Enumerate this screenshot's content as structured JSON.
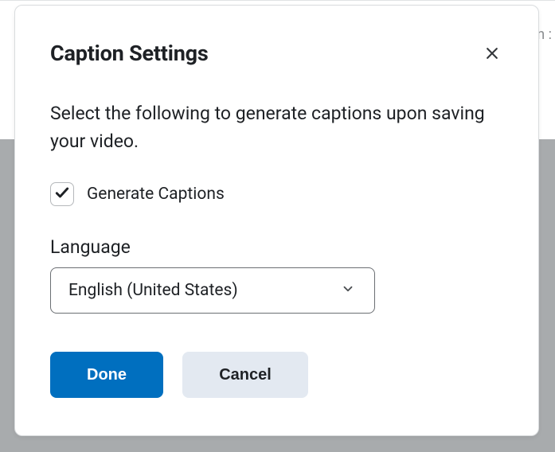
{
  "modal": {
    "title": "Caption Settings",
    "description": "Select the following to generate captions upon saving your video.",
    "generate": {
      "checked": true,
      "label": "Generate Captions"
    },
    "language": {
      "label": "Language",
      "selected": "English (United States)"
    },
    "buttons": {
      "done": "Done",
      "cancel": "Cancel"
    }
  },
  "backdrop": {
    "fragment": "n  :"
  }
}
